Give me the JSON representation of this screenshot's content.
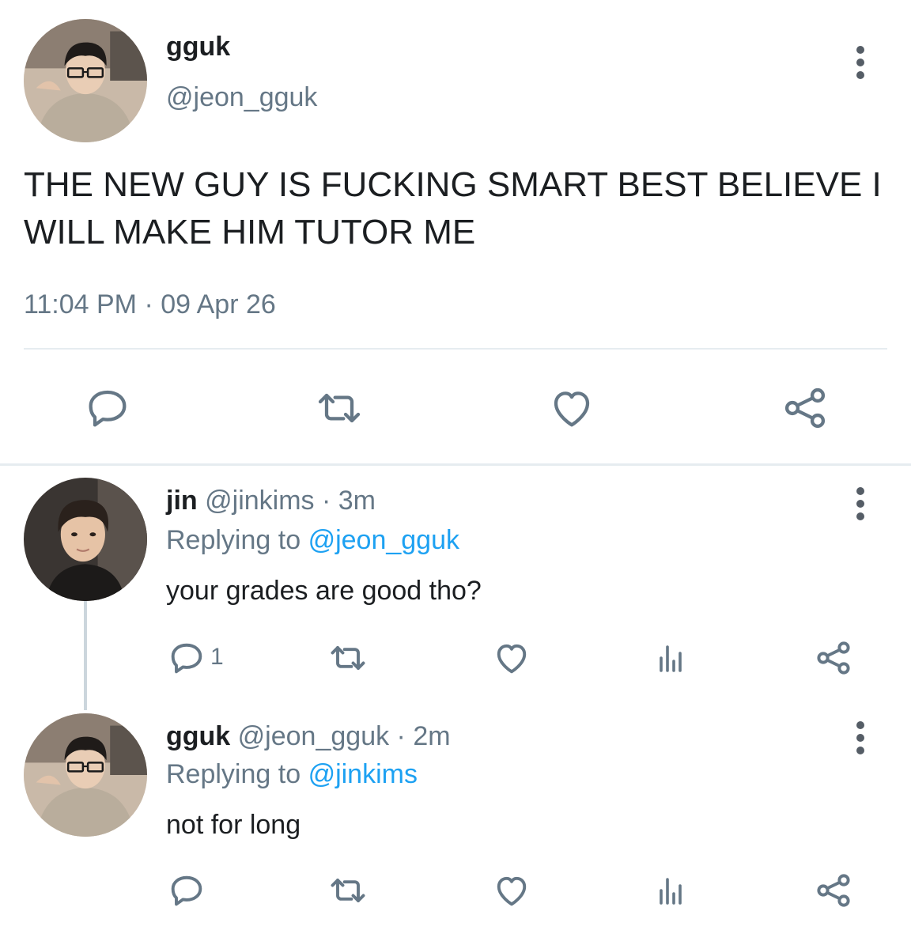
{
  "main_tweet": {
    "name": "gguk",
    "handle": "@jeon_gguk",
    "text": "THE NEW GUY IS FUCKING SMART BEST BELIEVE I WILL MAKE HIM TUTOR ME",
    "timestamp": "11:04 PM · 09 Apr 26",
    "avatar_icon": "profile-photo-gguk",
    "actions": [
      "reply-icon",
      "retweet-icon",
      "like-icon",
      "share-icon"
    ]
  },
  "replies": [
    {
      "name": "jin",
      "handle_time": "@jinkims · 3m",
      "replying_prefix": "Replying to",
      "replying_to": "@jeon_gguk",
      "text": "your grades are good tho?",
      "reply_count": "1",
      "avatar_icon": "profile-photo-jin"
    },
    {
      "name": "gguk",
      "handle_time": "@jeon_gguk · 2m",
      "replying_prefix": "Replying to",
      "replying_to": "@jinkims",
      "text": "not for long",
      "reply_count": "",
      "avatar_icon": "profile-photo-gguk"
    }
  ],
  "colors": {
    "link": "#1da1f2",
    "icon": "#657786",
    "divider": "#e6ecf0"
  }
}
